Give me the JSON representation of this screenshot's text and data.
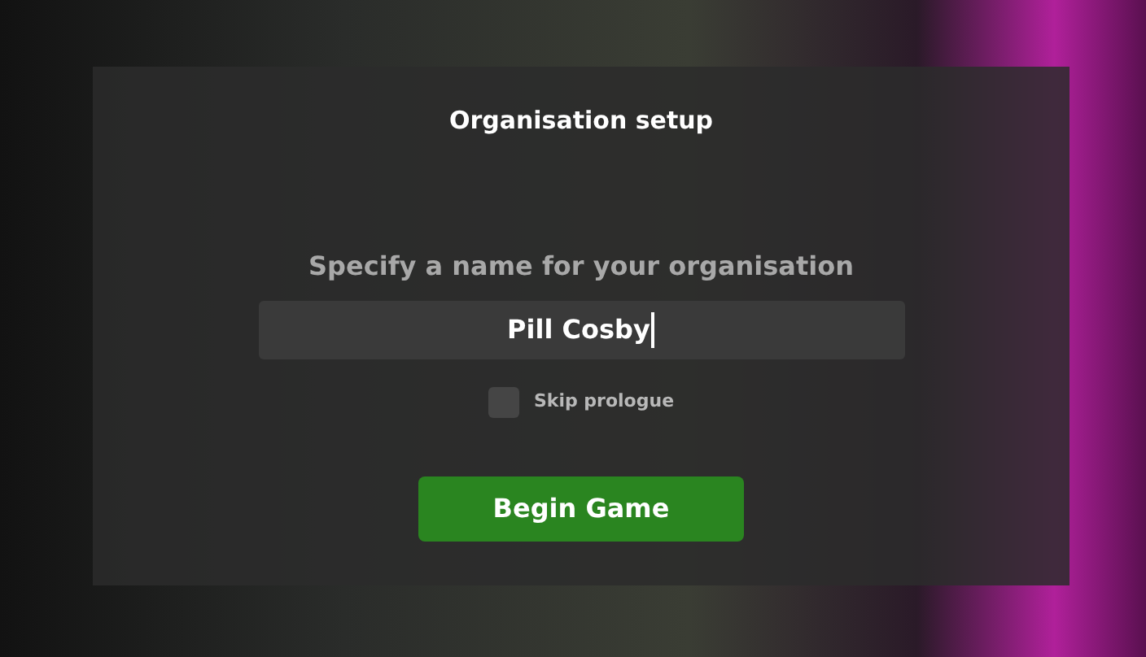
{
  "dialog": {
    "title": "Organisation setup",
    "prompt": "Specify a name for your organisation",
    "name_field": {
      "value": "Pill Cosby",
      "focused": true
    },
    "skip_prologue": {
      "label": "Skip prologue",
      "checked": false
    },
    "button": "Begin Game"
  }
}
